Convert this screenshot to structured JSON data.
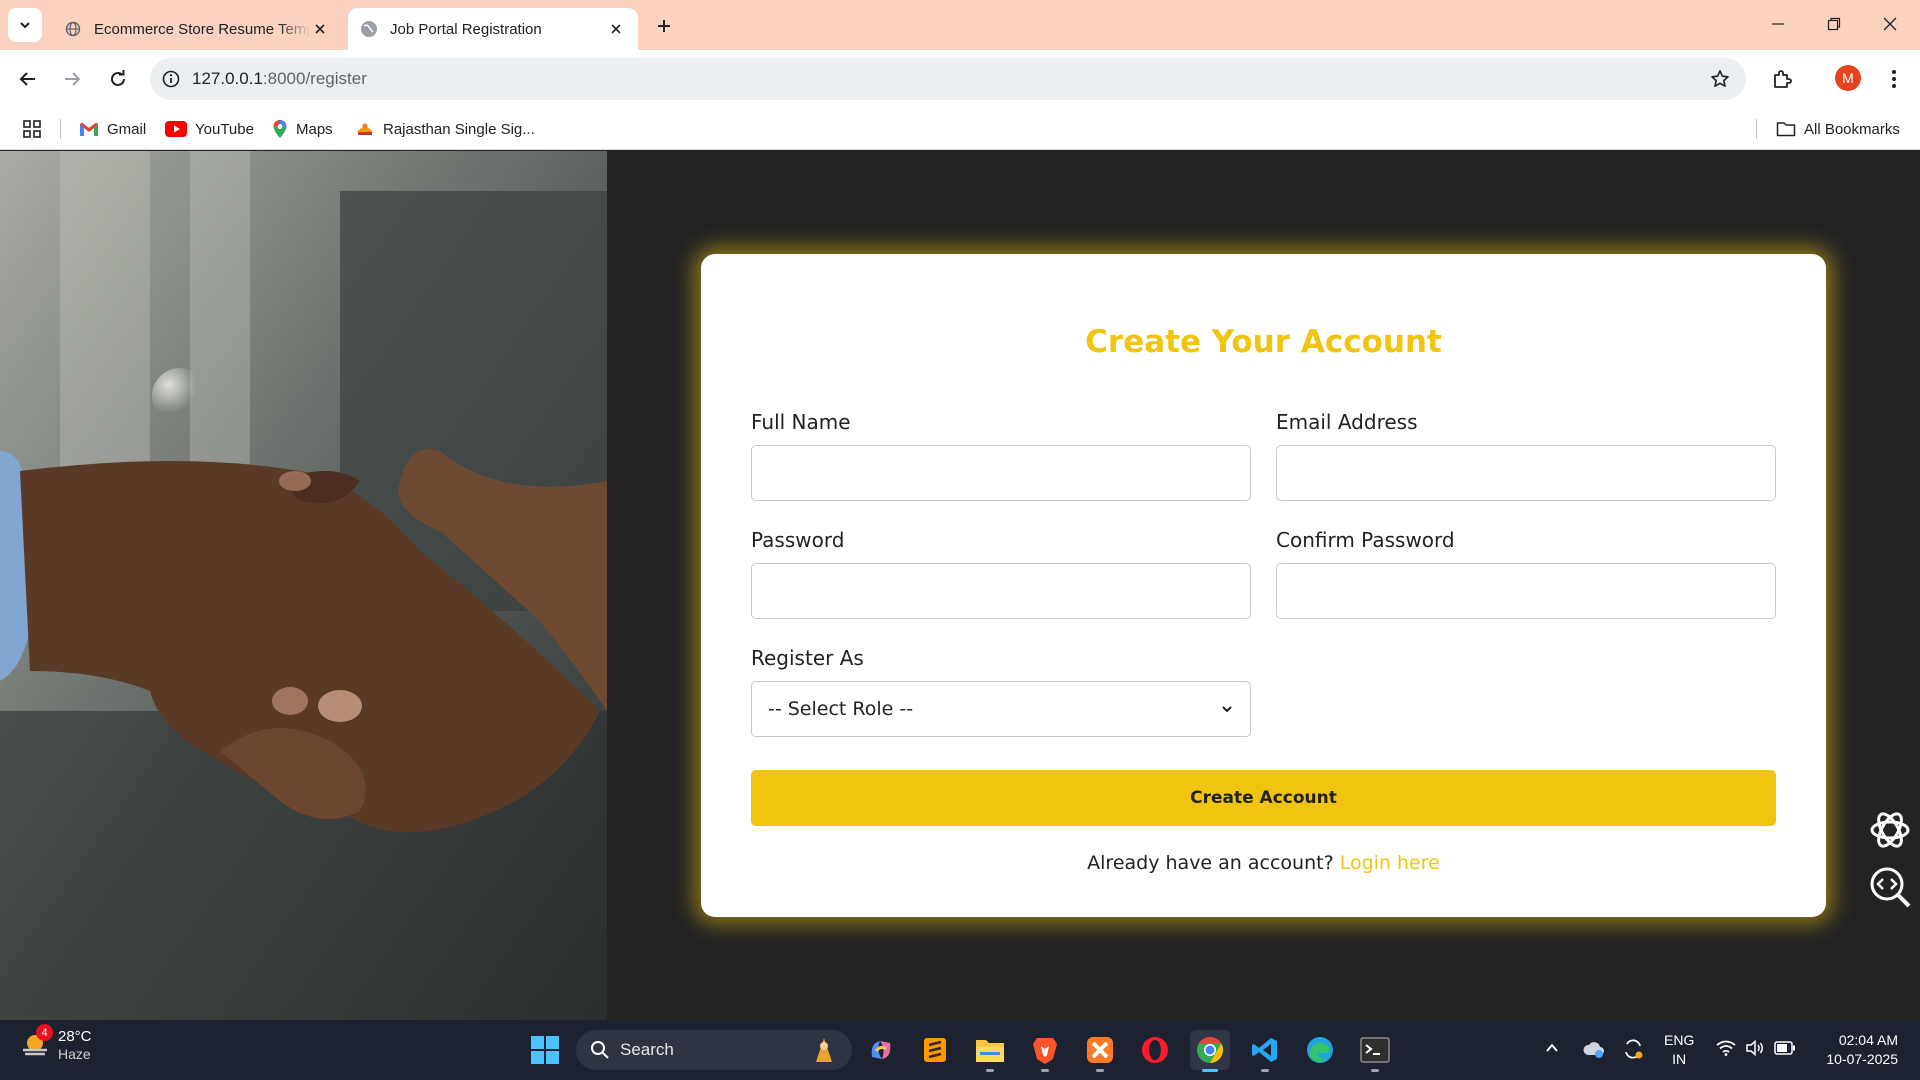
{
  "browser": {
    "tabs": [
      {
        "title": "Ecommerce Store Resume Temp",
        "active": false
      },
      {
        "title": "Job Portal Registration",
        "active": true
      }
    ],
    "url_host": "127.0.0.1",
    "url_path": ":8000/register",
    "profile_initial": "M",
    "bookmarks": [
      {
        "label": "Gmail",
        "icon": "gmail-icon"
      },
      {
        "label": "YouTube",
        "icon": "youtube-icon"
      },
      {
        "label": "Maps",
        "icon": "maps-icon"
      },
      {
        "label": "Rajasthan Single Sig...",
        "icon": "rajasthan-icon"
      }
    ],
    "all_bookmarks_label": "All Bookmarks"
  },
  "form": {
    "title": "Create Your Account",
    "full_name_label": "Full Name",
    "full_name_value": "",
    "email_label": "Email Address",
    "email_value": "",
    "password_label": "Password",
    "password_value": "",
    "confirm_password_label": "Confirm Password",
    "confirm_password_value": "",
    "role_label": "Register As",
    "role_selected": "-- Select Role --",
    "submit_label": "Create Account",
    "login_prompt": "Already have an account?",
    "login_link": "Login here"
  },
  "taskbar": {
    "weather_badge": "4",
    "temperature": "28°C",
    "condition": "Haze",
    "search_placeholder": "Search",
    "language": "ENG",
    "region": "IN",
    "time": "02:04 AM",
    "date": "10-07-2025"
  },
  "colors": {
    "accent": "#f1c40f",
    "page_background": "#232323",
    "tabstrip": "#fbd2c0"
  }
}
